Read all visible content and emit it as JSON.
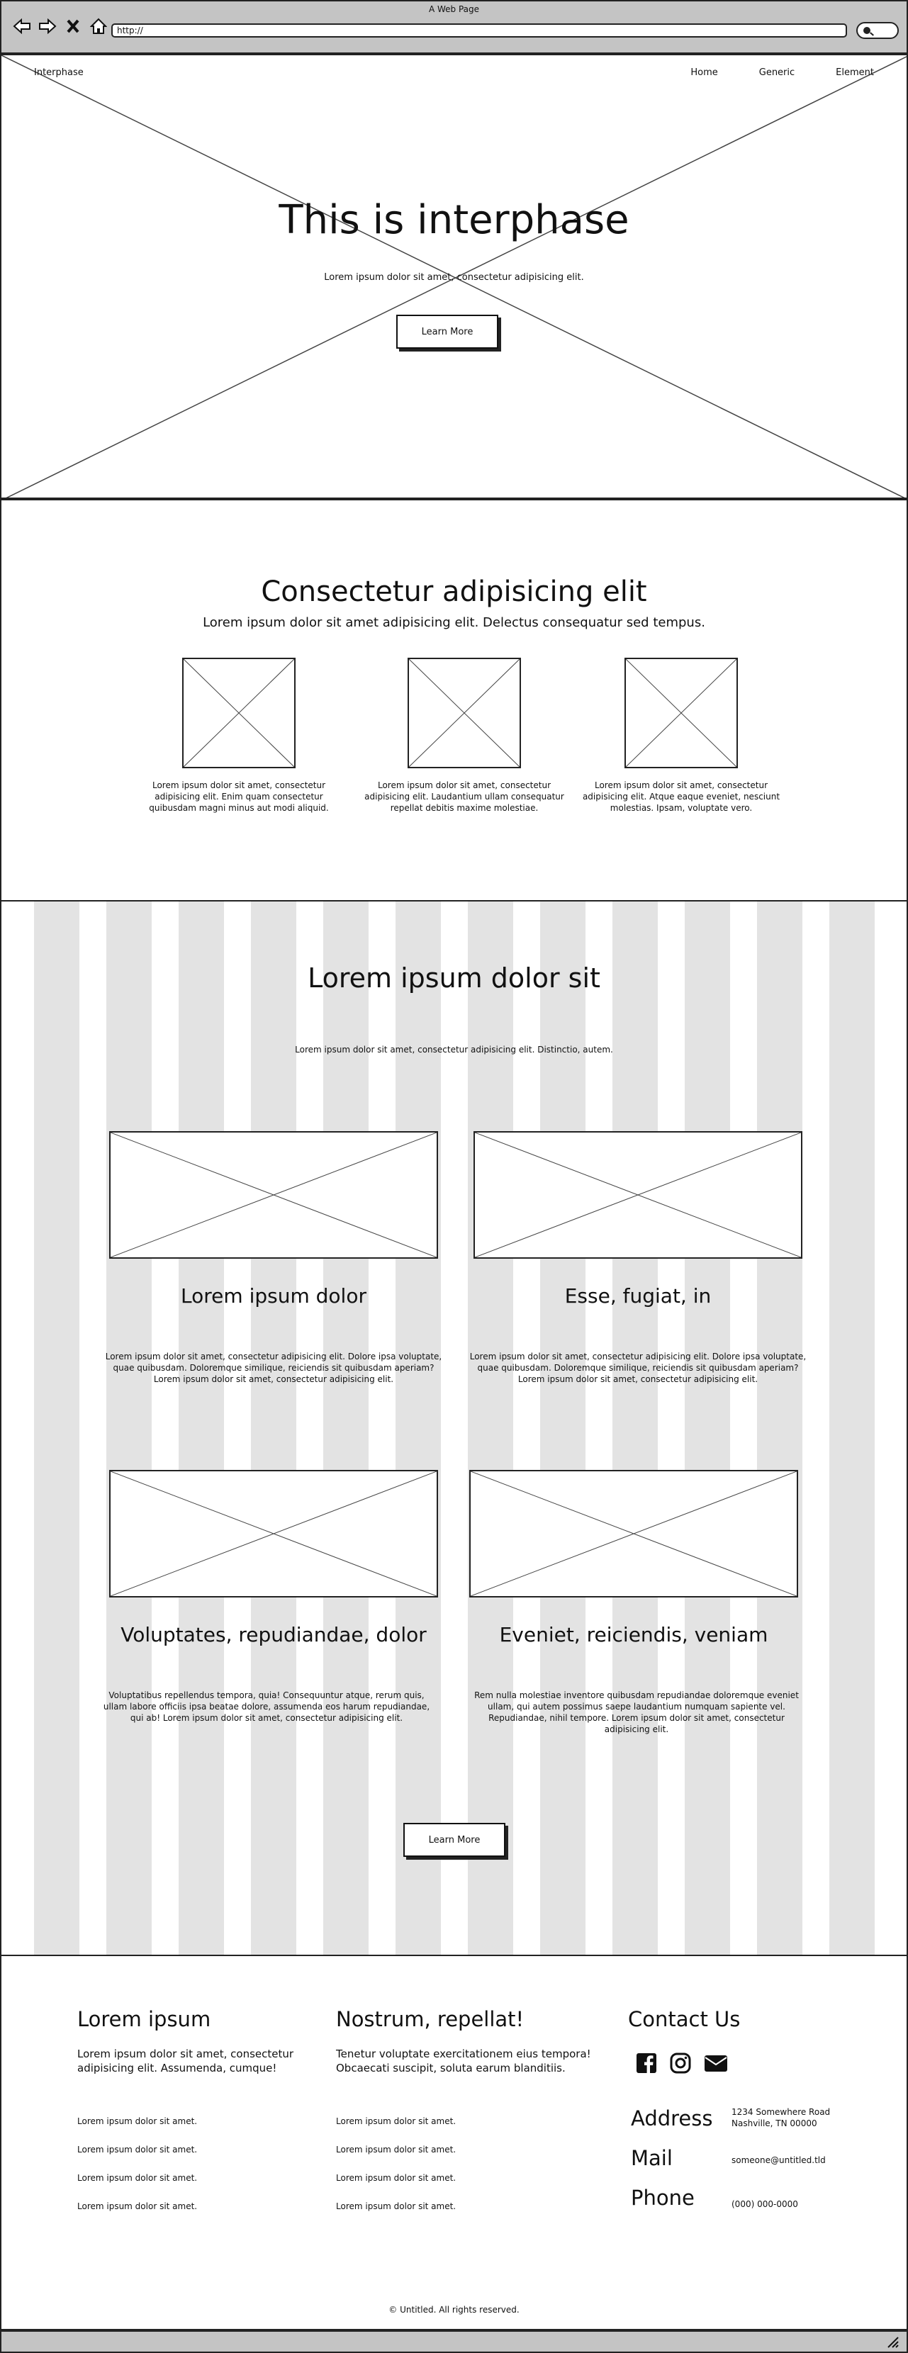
{
  "browser": {
    "title": "A Web Page",
    "url": "http://",
    "icons": [
      "back-arrow-icon",
      "forward-arrow-icon",
      "close-icon",
      "home-icon",
      "search-icon"
    ]
  },
  "hero": {
    "brand": "Interphase",
    "nav": [
      "Home",
      "Generic",
      "Element"
    ],
    "title": "This is interphase",
    "subtitle": "Lorem ipsum dolor sit amet, consectetur adipisicing elit.",
    "button": "Learn More"
  },
  "features": {
    "title": "Consectetur adipisicing elit",
    "lead": "Lorem ipsum dolor sit amet adipisicing elit. Delectus consequatur sed tempus.",
    "items": [
      {
        "text": "Lorem ipsum dolor sit amet, consectetur adipisicing elit. Enim quam consectetur quibusdam magni minus aut modi aliquid."
      },
      {
        "text": "Lorem ipsum dolor sit amet, consectetur adipisicing elit. Laudantium ullam consequatur repellat debitis maxime molestiae."
      },
      {
        "text": "Lorem ipsum dolor sit amet, consectetur adipisicing elit. Atque eaque eveniet, nesciunt molestias. Ipsam, voluptate vero."
      }
    ]
  },
  "gallery": {
    "title": "Lorem ipsum dolor sit",
    "subtitle": "Lorem ipsum dolor sit amet, consectetur adipisicing elit. Distinctio, autem.",
    "cards": [
      {
        "title": "Lorem ipsum dolor",
        "text": "Lorem ipsum dolor sit amet, consectetur adipisicing elit. Dolore ipsa voluptate, quae quibusdam. Doloremque similique, reiciendis sit quibusdam aperiam? Lorem ipsum dolor sit amet, consectetur adipisicing elit."
      },
      {
        "title": "Esse, fugiat, in",
        "text": "Lorem ipsum dolor sit amet, consectetur adipisicing elit. Dolore ipsa voluptate, quae quibusdam. Doloremque similique, reiciendis sit quibusdam aperiam? Lorem ipsum dolor sit amet, consectetur adipisicing elit."
      },
      {
        "title": "Voluptates, repudiandae, dolor",
        "text": "Voluptatibus repellendus tempora, quia! Consequuntur atque, rerum quis, ullam labore officiis ipsa beatae dolore, assumenda eos harum repudiandae, qui ab! Lorem ipsum dolor sit amet, consectetur adipisicing elit."
      },
      {
        "title": "Eveniet, reiciendis, veniam",
        "text": "Rem nulla molestiae inventore quibusdam repudiandae doloremque eveniet ullam, qui autem possimus saepe laudantium numquam sapiente vel. Repudiandae, nihil tempore. Lorem ipsum dolor sit amet, consectetur adipisicing elit."
      }
    ],
    "button": "Learn More"
  },
  "footer": {
    "col1": {
      "title": "Lorem ipsum",
      "text": "Lorem ipsum dolor sit amet, consectetur adipisicing elit. Assumenda, cumque!",
      "links": [
        "Lorem ipsum dolor sit amet.",
        "Lorem ipsum dolor sit amet.",
        "Lorem ipsum dolor sit amet.",
        "Lorem ipsum dolor sit amet."
      ]
    },
    "col2": {
      "title": "Nostrum, repellat!",
      "text": "Tenetur voluptate exercitationem eius tempora! Obcaecati suscipit, soluta earum blanditiis.",
      "links": [
        "Lorem ipsum dolor sit amet.",
        "Lorem ipsum dolor sit amet.",
        "Lorem ipsum dolor sit amet.",
        "Lorem ipsum dolor sit amet."
      ]
    },
    "contact": {
      "title": "Contact Us",
      "social": [
        "facebook-icon",
        "instagram-icon",
        "envelope-icon"
      ],
      "address_label": "Address",
      "address_line1": "1234 Somewhere Road",
      "address_line2": "Nashville, TN 00000",
      "mail_label": "Mail",
      "mail_value": "someone@untitled.tld",
      "phone_label": "Phone",
      "phone_value": "(000) 000-0000"
    },
    "copyright": "© Untitled. All rights reserved."
  }
}
